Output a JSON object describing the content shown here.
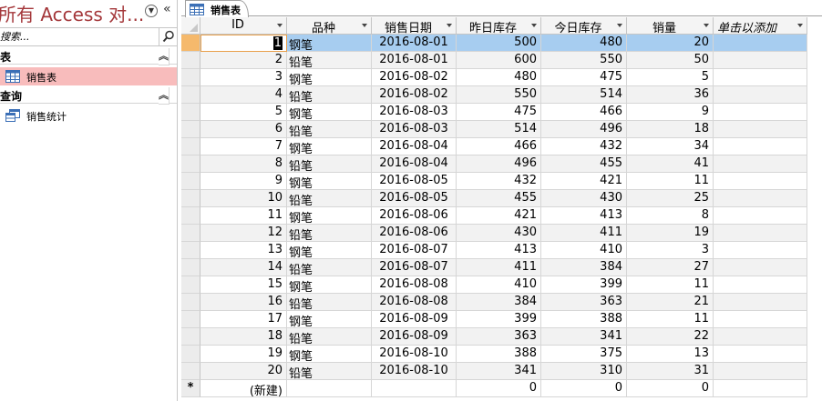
{
  "nav": {
    "title": "所有 Access 对...",
    "search_placeholder": "搜索...",
    "groups": [
      {
        "label": "表",
        "items": [
          {
            "label": "销售表"
          }
        ]
      },
      {
        "label": "查询",
        "items": [
          {
            "label": "销售统计"
          }
        ]
      }
    ]
  },
  "tab": {
    "label": "销售表"
  },
  "table": {
    "columns": [
      "ID",
      "品种",
      "销售日期",
      "昨日库存",
      "今日库存",
      "销量",
      "单击以添加"
    ],
    "rows": [
      [
        "1",
        "钢笔",
        "2016-08-01",
        "500",
        "480",
        "20"
      ],
      [
        "2",
        "铅笔",
        "2016-08-01",
        "600",
        "550",
        "50"
      ],
      [
        "3",
        "钢笔",
        "2016-08-02",
        "480",
        "475",
        "5"
      ],
      [
        "4",
        "铅笔",
        "2016-08-02",
        "550",
        "514",
        "36"
      ],
      [
        "5",
        "钢笔",
        "2016-08-03",
        "475",
        "466",
        "9"
      ],
      [
        "6",
        "铅笔",
        "2016-08-03",
        "514",
        "496",
        "18"
      ],
      [
        "7",
        "钢笔",
        "2016-08-04",
        "466",
        "432",
        "34"
      ],
      [
        "8",
        "铅笔",
        "2016-08-04",
        "496",
        "455",
        "41"
      ],
      [
        "9",
        "钢笔",
        "2016-08-05",
        "432",
        "421",
        "11"
      ],
      [
        "10",
        "铅笔",
        "2016-08-05",
        "455",
        "430",
        "25"
      ],
      [
        "11",
        "钢笔",
        "2016-08-06",
        "421",
        "413",
        "8"
      ],
      [
        "12",
        "铅笔",
        "2016-08-06",
        "430",
        "411",
        "19"
      ],
      [
        "13",
        "钢笔",
        "2016-08-07",
        "413",
        "410",
        "3"
      ],
      [
        "14",
        "铅笔",
        "2016-08-07",
        "411",
        "384",
        "27"
      ],
      [
        "15",
        "钢笔",
        "2016-08-08",
        "410",
        "399",
        "11"
      ],
      [
        "16",
        "铅笔",
        "2016-08-08",
        "384",
        "363",
        "21"
      ],
      [
        "17",
        "钢笔",
        "2016-08-09",
        "399",
        "388",
        "11"
      ],
      [
        "18",
        "铅笔",
        "2016-08-09",
        "363",
        "341",
        "22"
      ],
      [
        "19",
        "钢笔",
        "2016-08-10",
        "388",
        "375",
        "13"
      ],
      [
        "20",
        "铅笔",
        "2016-08-10",
        "341",
        "310",
        "31"
      ]
    ],
    "new_row": {
      "marker": "*",
      "id": "(新建)",
      "yesterday": "0",
      "today": "0",
      "sales": "0"
    }
  },
  "colors": {
    "selected_row": "#a7cdf0",
    "nav_selected": "#f8bcbc",
    "title_red": "#a4373a",
    "record_selector_current": "#f5b96c"
  }
}
